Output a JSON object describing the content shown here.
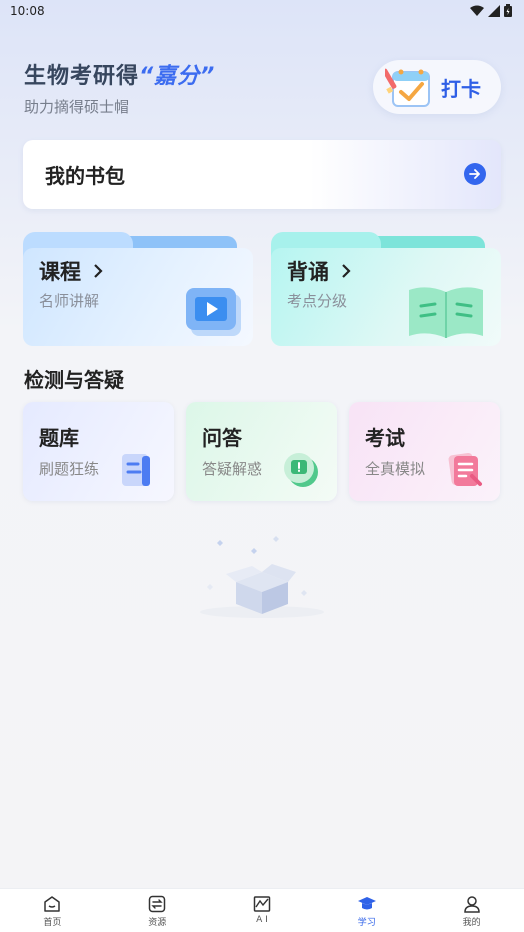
{
  "status_bar": {
    "time": "10:08"
  },
  "hero": {
    "title_main": "生物考研得",
    "title_accent": "“嘉分”",
    "subtitle": "助力摘得硕士帽"
  },
  "checkin": {
    "label": "打卡",
    "icon": "calendar-check-icon"
  },
  "bookbag": {
    "label": "我的书包",
    "icon": "arrow-right-circle-icon"
  },
  "folders": [
    {
      "title": "课程",
      "subtitle": "名师讲解",
      "icon": "video-play-icon"
    },
    {
      "title": "背诵",
      "subtitle": "考点分级",
      "icon": "open-book-icon"
    }
  ],
  "section": {
    "title": "检测与答疑"
  },
  "tools": [
    {
      "title": "题库",
      "subtitle": "刷题狂练",
      "icon": "question-bank-icon"
    },
    {
      "title": "问答",
      "subtitle": "答疑解惑",
      "icon": "chat-bubble-icon"
    },
    {
      "title": "考试",
      "subtitle": "全真模拟",
      "icon": "exam-paper-icon"
    }
  ],
  "tab_bar": {
    "items": [
      {
        "label": "首页",
        "icon": "home-icon"
      },
      {
        "label": "资源",
        "icon": "exchange-icon"
      },
      {
        "label": "A I",
        "icon": "chart-icon"
      },
      {
        "label": "学习",
        "icon": "graduation-cap-icon",
        "active": true
      },
      {
        "label": "我的",
        "icon": "user-icon"
      }
    ],
    "active_color": "#2f62e8"
  },
  "colors": {
    "accent": "#3c6cf0",
    "primary_blue": "#3366ee"
  }
}
